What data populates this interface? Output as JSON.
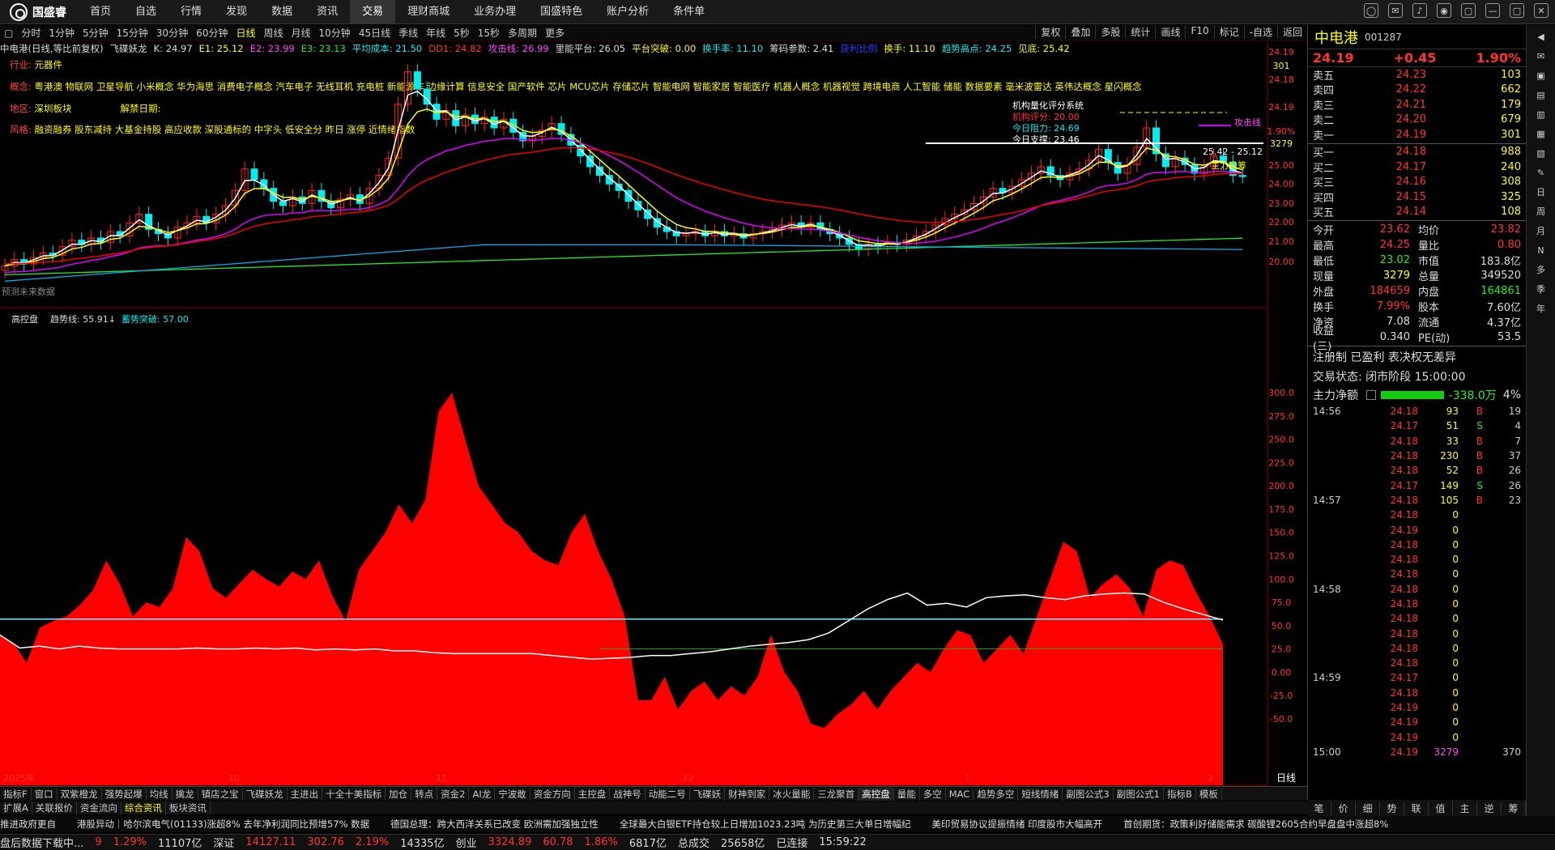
{
  "app": {
    "name": "国盛睿"
  },
  "menu": [
    "首页",
    "自选",
    "行情",
    "发现",
    "数据",
    "资讯",
    "交易",
    "理财商城",
    "业务办理",
    "国盛特色",
    "账户分析",
    "条件单"
  ],
  "periods": [
    "分时",
    "1分钟",
    "5分钟",
    "15分钟",
    "30分钟",
    "60分钟",
    "日线",
    "周线",
    "月线",
    "10分钟",
    "45日线",
    "季线",
    "年线",
    "5秒",
    "15秒",
    "多周期",
    "更多"
  ],
  "active_period": "日线",
  "right_tools": [
    "复权",
    "叠加",
    "多股",
    "统计",
    "画线",
    "F10",
    "标记",
    "-自选",
    "返回"
  ],
  "indicators": [
    {
      "text": "中电港(日线,等比前复权)",
      "color": "#ddd"
    },
    {
      "text": "飞碟妖龙",
      "color": "#ddd"
    },
    {
      "text": "K: 24.97",
      "color": "#ddd"
    },
    {
      "text": "E1: 25.12",
      "color": "#ff0"
    },
    {
      "text": "E2: 23.99",
      "color": "#f4f"
    },
    {
      "text": "E3: 23.13",
      "color": "#2e2"
    },
    {
      "text": "平均成本: 21.50",
      "color": "#0ee"
    },
    {
      "text": "DD1: 24.82",
      "color": "#f33"
    },
    {
      "text": "攻击线: 26.99",
      "color": "#f4f"
    },
    {
      "text": "里能平台: 26.05",
      "color": "#ddd"
    },
    {
      "text": "平台突破: 0.00",
      "color": "#ff0"
    },
    {
      "text": "换手率: 11.10",
      "color": "#0ee"
    },
    {
      "text": "筹码参数: 2.41",
      "color": "#ddd"
    },
    {
      "text": "获利比例",
      "color": "#33f"
    },
    {
      "text": "换手: 11.10",
      "color": "#ff0"
    },
    {
      "text": "趋势高点: 24.25",
      "color": "#0ee"
    },
    {
      "text": "见底: 25.42",
      "color": "#ff0"
    }
  ],
  "info": {
    "industry_label": "行业:",
    "industry": "元器件",
    "concept_label": "概念:",
    "concept": "粤港澳 物联网 卫星导航 小米概念 华为海思 消费电子概念 汽车电子 无线耳机 充电桩 新能源车 边缘计算 信息安全 国产软件 芯片 MCU芯片 存储芯片 智能电网 智能家居 智能医疗 机器人概念 机器视觉 跨境电商 人工智能 储能 数据要素 毫米波雷达 英伟达概念 星闪概念",
    "region_label": "地区:",
    "region": "深圳板块",
    "lift_label": "解禁日期:",
    "style_label": "风格:",
    "style": "融资融券 股东减持 大基金持股 高应收款 深股通标的 中字头 低安全分 昨日 涨停 近情绪指数"
  },
  "quant": {
    "title": "机构量化评分系统",
    "score": "机构评分: 20.00",
    "resist": "今日阻力: 24.69",
    "support": "今日支撑: 23.46",
    "range": "25.42 - 25.12",
    "tag_main": "主力吸筹",
    "tag_attack": "攻击线",
    "forecast": "预测未来数据"
  },
  "price_axis": [
    "24.19",
    "301",
    "24.18",
    "24.19",
    "1.90%",
    "3279",
    "25.00",
    "24.00",
    "23.00",
    "22.00",
    "21.00",
    "20.00"
  ],
  "chart_data": {
    "type": "area",
    "title": "高控盘",
    "series": [
      {
        "name": "趋势线",
        "values": [
          55.91
        ]
      },
      {
        "name": "蓄势突破",
        "values": [
          57.0
        ]
      }
    ],
    "ylim": [
      -50,
      300
    ],
    "yticks": [
      "300.0",
      "275.0",
      "250.0",
      "225.0",
      "200.0",
      "175.0",
      "150.0",
      "125.0",
      "100.0",
      "75.0",
      "50.0",
      "25.0",
      "0.00",
      "-25.0",
      "-50.0"
    ],
    "xlabels": [
      "2025年",
      "10",
      "11",
      "12",
      "1",
      "2"
    ],
    "red_area": [
      40,
      32,
      10,
      48,
      55,
      60,
      72,
      88,
      120,
      95,
      60,
      75,
      70,
      90,
      145,
      130,
      90,
      80,
      95,
      110,
      100,
      92,
      108,
      100,
      120,
      82,
      55,
      110,
      130,
      150,
      180,
      160,
      185,
      280,
      300,
      250,
      200,
      180,
      160,
      150,
      130,
      120,
      115,
      150,
      170,
      130,
      100,
      60,
      -30,
      -30,
      -5,
      -40,
      -20,
      -10,
      -30,
      -15,
      -25,
      -5,
      40,
      0,
      -20,
      -55,
      -60,
      -45,
      -35,
      -20,
      -40,
      -20,
      -5,
      10,
      0,
      25,
      45,
      40,
      10,
      25,
      40,
      20,
      60,
      100,
      140,
      130,
      80,
      95,
      105,
      90,
      60,
      110,
      120,
      115,
      85,
      60,
      30
    ],
    "white_line": [
      40,
      26,
      28,
      25,
      28,
      26,
      25,
      25,
      25,
      25,
      26,
      25,
      25,
      26,
      25,
      26,
      24,
      25,
      24,
      25,
      23,
      23,
      21,
      20,
      20,
      20,
      20,
      20,
      18,
      16,
      14,
      15,
      16,
      18,
      18,
      20,
      22,
      25,
      28,
      30,
      32,
      35,
      42,
      55,
      68,
      78,
      85,
      72,
      74,
      70,
      80,
      82,
      83,
      80,
      78,
      82,
      84,
      85,
      84,
      75,
      68,
      62,
      56
    ]
  },
  "right": {
    "name": "中电港",
    "code": "001287",
    "price": "24.19",
    "change": "+0.45",
    "pct": "1.90%",
    "asks": [
      [
        "卖五",
        "24.23",
        "103"
      ],
      [
        "卖四",
        "24.22",
        "662"
      ],
      [
        "卖三",
        "24.21",
        "179"
      ],
      [
        "卖二",
        "24.20",
        "679"
      ],
      [
        "卖一",
        "24.19",
        "301"
      ]
    ],
    "bids": [
      [
        "买一",
        "24.18",
        "988"
      ],
      [
        "买二",
        "24.17",
        "240"
      ],
      [
        "买三",
        "24.16",
        "308"
      ],
      [
        "买四",
        "24.15",
        "325"
      ],
      [
        "买五",
        "24.14",
        "108"
      ]
    ],
    "stats": [
      [
        "今开",
        "23.62",
        "均价",
        "23.82"
      ],
      [
        "最高",
        "24.25",
        "量比",
        "0.80"
      ],
      [
        "最低",
        "23.02",
        "市值",
        "183.8亿"
      ],
      [
        "现量",
        "3279",
        "总量",
        "349520"
      ],
      [
        "外盘",
        "184659",
        "内盘",
        "164861"
      ],
      [
        "换手",
        "7.99%",
        "股本",
        "7.60亿"
      ],
      [
        "净资",
        "7.08",
        "流通",
        "4.37亿"
      ],
      [
        "收益(三)",
        "0.340",
        "PE(动)",
        "53.5"
      ]
    ],
    "reg": "注册制 已盈利 表决权无差异",
    "trade_state": "交易状态: 闭市阶段 15:00:00",
    "main_flow_label": "主力净额",
    "main_flow": "-338.0万",
    "main_flow_pct": "4%",
    "ticks": [
      [
        "14:56",
        "24.18",
        "93",
        "B",
        "19"
      ],
      [
        "",
        "24.17",
        "51",
        "S",
        "4"
      ],
      [
        "",
        "24.18",
        "33",
        "B",
        "7"
      ],
      [
        "",
        "24.18",
        "230",
        "B",
        "37"
      ],
      [
        "",
        "24.18",
        "52",
        "B",
        "26"
      ],
      [
        "",
        "24.17",
        "149",
        "S",
        "26"
      ],
      [
        "14:57",
        "24.18",
        "105",
        "B",
        "23"
      ],
      [
        "",
        "24.18",
        "0",
        "",
        ""
      ],
      [
        "",
        "24.19",
        "0",
        "",
        ""
      ],
      [
        "",
        "24.18",
        "0",
        "",
        ""
      ],
      [
        "",
        "24.18",
        "0",
        "",
        ""
      ],
      [
        "",
        "24.18",
        "0",
        "",
        ""
      ],
      [
        "14:58",
        "24.18",
        "0",
        "",
        ""
      ],
      [
        "",
        "24.18",
        "0",
        "",
        ""
      ],
      [
        "",
        "24.18",
        "0",
        "",
        ""
      ],
      [
        "",
        "24.18",
        "0",
        "",
        ""
      ],
      [
        "",
        "24.18",
        "0",
        "",
        ""
      ],
      [
        "",
        "24.18",
        "0",
        "",
        ""
      ],
      [
        "14:59",
        "24.17",
        "0",
        "",
        ""
      ],
      [
        "",
        "24.18",
        "0",
        "",
        ""
      ],
      [
        "",
        "24.19",
        "0",
        "",
        ""
      ],
      [
        "",
        "24.19",
        "0",
        "",
        ""
      ],
      [
        "",
        "24.19",
        "0",
        "",
        ""
      ],
      [
        "15:00",
        "24.19",
        "3279",
        "",
        "370"
      ]
    ],
    "bottom_tabs": [
      "笔",
      "价",
      "细",
      "势",
      "联",
      "值",
      "主",
      "逆",
      "筹"
    ]
  },
  "side_strip": [
    "日",
    "周",
    "月",
    "N",
    "多",
    "季",
    "年"
  ],
  "bottom_tabs": [
    "指标F",
    "窗口",
    "双紫橙龙",
    "强势起爆",
    "均线",
    "擒龙",
    "镇店之宝",
    "飞碟妖龙",
    "主进出",
    "十全十美指标",
    "加仓",
    "转点",
    "资金2",
    "AI龙",
    "宁波敢",
    "资金方向",
    "主控盘",
    "战神号",
    "动能二号",
    "飞碟妖",
    "财神到家",
    "冰火量能",
    "三龙聚首",
    "高控盘",
    "量能",
    "多空",
    "MAC",
    "趋势多空",
    "短线情绪",
    "副图公式3",
    "副图公式1",
    "指标B",
    "模板"
  ],
  "bottom_tabs2": [
    "扩展A",
    "关联报价",
    "资金流向",
    "综合资讯",
    "板块资讯"
  ],
  "news": [
    "推进政府更自",
    "港股异动｜哈尔滨电气(01133)涨超8% 去年净利润同比预增57% 数据",
    "德国总理：跨大西洋关系已改变 欧洲需加强独立性",
    "全球最大白银ETF持仓较上日增加1023.23吨 为历史第三大单日增幅纪",
    "美印贸易协议提振情绪 印度股市大幅高开",
    "首创期货：政策利好储能需求 碳酸锂2605合约早盘盘中涨超8%"
  ],
  "status": [
    {
      "t": "盘后数据下载中...",
      "c": "#ddd"
    },
    {
      "t": "9",
      "c": "#f33"
    },
    {
      "t": "1.29%",
      "c": "#f33"
    },
    {
      "t": "11107亿",
      "c": "#ddd"
    },
    {
      "t": "深证",
      "c": "#ddd"
    },
    {
      "t": "14127.11",
      "c": "#f33"
    },
    {
      "t": "302.76",
      "c": "#f33"
    },
    {
      "t": "2.19%",
      "c": "#f33"
    },
    {
      "t": "14335亿",
      "c": "#ddd"
    },
    {
      "t": "创业",
      "c": "#ddd"
    },
    {
      "t": "3324.89",
      "c": "#f33"
    },
    {
      "t": "60.78",
      "c": "#f33"
    },
    {
      "t": "1.86%",
      "c": "#f33"
    },
    {
      "t": "6817亿",
      "c": "#ddd"
    },
    {
      "t": "总成交",
      "c": "#ddd"
    },
    {
      "t": "25658亿",
      "c": "#ddd"
    },
    {
      "t": "已连接",
      "c": "#ddd"
    },
    {
      "t": "15:59:22",
      "c": "#ddd"
    }
  ],
  "window_label": "日线",
  "x_year_label": "2025年"
}
